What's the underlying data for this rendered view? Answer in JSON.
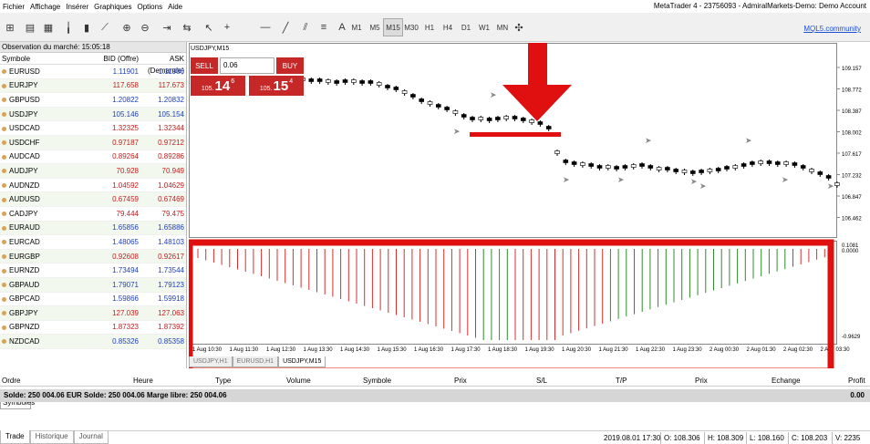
{
  "menu": [
    "Fichier",
    "Affichage",
    "Insérer",
    "Graphiques",
    "Options",
    "Aide"
  ],
  "window_title": "MetaTrader 4 - 23756093 - AdmiralMarkets-Demo: Demo Account",
  "toolbar": {
    "timeframes": [
      "M1",
      "M5",
      "M15",
      "M30",
      "H1",
      "H4",
      "D1",
      "W1",
      "MN"
    ],
    "active_timeframe": "M15",
    "mql_link": "MQL5.community"
  },
  "market_watch": {
    "title": "Observation du marché: 15:05:18",
    "col_symbol": "Symbole",
    "col_bid": "BID (Offre)",
    "col_ask": "ASK (Demande)",
    "rows": [
      {
        "symbol": "EURUSD",
        "bid": "1.11901",
        "ask": "1.11906",
        "color": "blue"
      },
      {
        "symbol": "EURJPY",
        "bid": "117.658",
        "ask": "117.673",
        "color": "red"
      },
      {
        "symbol": "GBPUSD",
        "bid": "1.20822",
        "ask": "1.20832",
        "color": "blue"
      },
      {
        "symbol": "USDJPY",
        "bid": "105.146",
        "ask": "105.154",
        "color": "blue"
      },
      {
        "symbol": "USDCAD",
        "bid": "1.32325",
        "ask": "1.32344",
        "color": "red"
      },
      {
        "symbol": "USDCHF",
        "bid": "0.97187",
        "ask": "0.97212",
        "color": "red"
      },
      {
        "symbol": "AUDCAD",
        "bid": "0.89264",
        "ask": "0.89286",
        "color": "red"
      },
      {
        "symbol": "AUDJPY",
        "bid": "70.928",
        "ask": "70.949",
        "color": "red"
      },
      {
        "symbol": "AUDNZD",
        "bid": "1.04592",
        "ask": "1.04629",
        "color": "red"
      },
      {
        "symbol": "AUDUSD",
        "bid": "0.67459",
        "ask": "0.67469",
        "color": "red"
      },
      {
        "symbol": "CADJPY",
        "bid": "79.444",
        "ask": "79.475",
        "color": "red"
      },
      {
        "symbol": "EURAUD",
        "bid": "1.65856",
        "ask": "1.65886",
        "color": "blue"
      },
      {
        "symbol": "EURCAD",
        "bid": "1.48065",
        "ask": "1.48103",
        "color": "blue"
      },
      {
        "symbol": "EURGBP",
        "bid": "0.92608",
        "ask": "0.92617",
        "color": "red"
      },
      {
        "symbol": "EURNZD",
        "bid": "1.73494",
        "ask": "1.73544",
        "color": "blue"
      },
      {
        "symbol": "GBPAUD",
        "bid": "1.79071",
        "ask": "1.79123",
        "color": "blue"
      },
      {
        "symbol": "GBPCAD",
        "bid": "1.59866",
        "ask": "1.59918",
        "color": "blue"
      },
      {
        "symbol": "GBPJPY",
        "bid": "127.039",
        "ask": "127.063",
        "color": "red"
      },
      {
        "symbol": "GBPNZD",
        "bid": "1.87323",
        "ask": "1.87392",
        "color": "red"
      },
      {
        "symbol": "NZDCAD",
        "bid": "0.85326",
        "ask": "0.85358",
        "color": "blue"
      }
    ],
    "tab": "Symboles"
  },
  "chart": {
    "symbol_label": "USDJPY,M15",
    "sell_label": "SELL",
    "buy_label": "BUY",
    "lot": "0.06",
    "sell_price": {
      "prefix": "105.",
      "big": "14",
      "sup": "6"
    },
    "buy_price": {
      "prefix": "105.",
      "big": "15",
      "sup": "4"
    },
    "price_ticks": [
      "109.157",
      "108.772",
      "108.387",
      "108.002",
      "107.617",
      "107.232",
      "106.847",
      "106.462"
    ],
    "osc_ticks": [
      "0.1081",
      "0.0000",
      "-0.9629"
    ],
    "time_ticks": [
      "1 Aug 10:30",
      "1 Aug 11:30",
      "1 Aug 12:30",
      "1 Aug 13:30",
      "1 Aug 14:30",
      "1 Aug 15:30",
      "1 Aug 16:30",
      "1 Aug 17:30",
      "1 Aug 18:30",
      "1 Aug 19:30",
      "1 Aug 20:30",
      "1 Aug 21:30",
      "1 Aug 22:30",
      "1 Aug 23:30",
      "2 Aug 00:30",
      "2 Aug 01:30",
      "2 Aug 02:30",
      "2 Aug 03:30"
    ],
    "tabs": [
      "USDJPY,H1",
      "EURUSD,H1",
      "USDJPY,M15"
    ],
    "active_tab": "USDJPY,M15",
    "annotation_color": "#e01010"
  },
  "terminal": {
    "columns": [
      "Ordre",
      "Heure",
      "Type",
      "Volume",
      "Symbole",
      "Prix",
      "S/L",
      "T/P",
      "Prix",
      "Echange",
      "Profit"
    ],
    "balance_line": "Solde: 250 004.06 EUR  Solde: 250 004.06  Marge libre: 250 004.06",
    "profit_total": "0.00",
    "tabs": [
      "Trade",
      "Historique",
      "Journal"
    ],
    "active_tab": "Trade"
  },
  "status": {
    "datetime": "2019.08.01 17:30",
    "open": "O: 108.306",
    "high": "H: 108.309",
    "low": "L: 108.160",
    "close": "C: 108.203",
    "volume": "V: 2235"
  }
}
